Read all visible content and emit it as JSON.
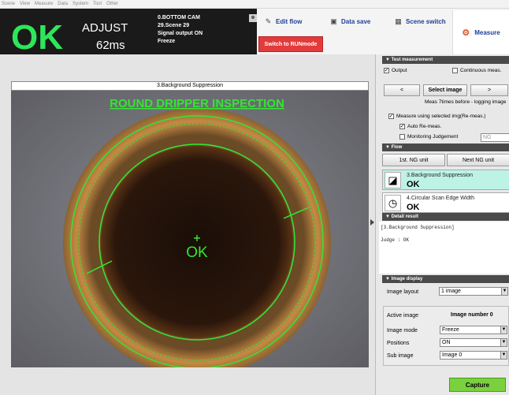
{
  "menu": [
    "Scene",
    "View",
    "Measure",
    "Data",
    "System",
    "Tool",
    "Other"
  ],
  "status": {
    "judgement": "OK",
    "mode": "ADJUST",
    "time": "62ms",
    "camera": "0.BOTTOM CAM",
    "scene": "29.Scene 29",
    "signal": "Signal output ON",
    "image_mode": "Freeze"
  },
  "toolbar": {
    "edit_flow": "Edit flow",
    "data_save": "Data save",
    "scene_switch": "Scene switch",
    "run_mode": "Switch to RUNmode",
    "measure": "Measure"
  },
  "image_window": {
    "title": "3.Background Suppression",
    "overlay_title": "ROUND DRIPPER INSPECTION",
    "overlay_result": "OK"
  },
  "test_measurement": {
    "header": "Test measurement",
    "output_label": "Output",
    "output_checked": true,
    "continuous_label": "Continuous meas.",
    "continuous_checked": false,
    "prev_label": "<",
    "select_label": "Select image",
    "next_label": ">",
    "info": "Meas 7times before - logging image",
    "use_selected_label": "Measure using selected img(Re-meas.)",
    "use_selected_checked": true,
    "auto_remeas_label": "Auto Re-meas.",
    "auto_remeas_checked": true,
    "monitoring_label": "Monitoring Judgement",
    "monitoring_checked": false,
    "monitoring_value": "NG"
  },
  "flow": {
    "header": "Flow",
    "first_ng": "1st. NG unit",
    "next_ng": "Next NG unit",
    "items": [
      {
        "name": "3.Background Suppression",
        "result": "OK",
        "icon": "background-suppression-icon"
      },
      {
        "name": "4.Circular Scan Edge Width",
        "result": "OK",
        "icon": "circular-scan-icon"
      }
    ]
  },
  "detail_result": {
    "header": "Detail result",
    "lines": [
      "[3.Background Suppression]",
      "",
      "Judge : OK"
    ]
  },
  "image_display": {
    "header": "Image display",
    "layout_label": "Image layout",
    "layout_value": "1 image",
    "active_label": "Active image",
    "active_value": "Image number 0",
    "mode_label": "Image mode",
    "mode_value": "Freeze",
    "positions_label": "Positions",
    "positions_value": "ON",
    "sub_label": "Sub image",
    "sub_value": "Image 0"
  },
  "capture_label": "Capture",
  "colors": {
    "ok_green": "#2ee65a",
    "overlay_green": "#33e633",
    "run_red": "#e33b3b",
    "selected_flow": "#bdf3e5",
    "capture_green": "#7ad13d"
  }
}
